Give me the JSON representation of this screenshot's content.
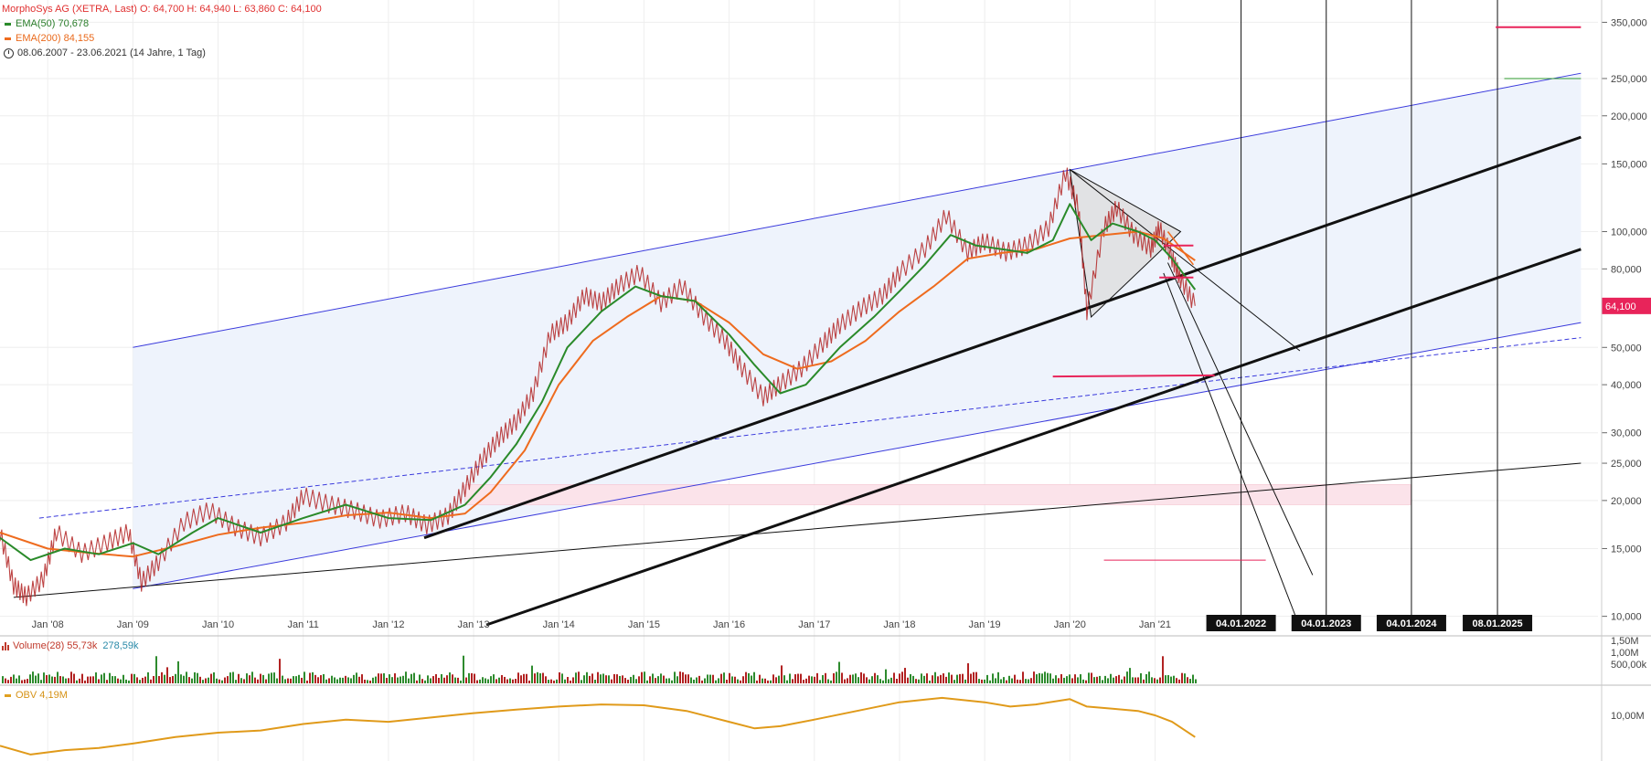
{
  "legend": {
    "title": "MorphoSys AG (XETRA, Last)  O: 64,700  H: 64,940  L: 63,860  C: 64,100",
    "ema50": "EMA(50)  70,678",
    "ema200": "EMA(200)  84,155",
    "range": "08.06.2007 - 23.06.2021   (14 Jahre, 1 Tag)"
  },
  "volume_legend": {
    "label": "Volume(28)  55,73k",
    "avg": "278,59k"
  },
  "obv_legend": {
    "label": "OBV  4,19M"
  },
  "colors": {
    "price_up": "#2e8b2e",
    "price_down": "#b22222",
    "ema50": "#2a8a2a",
    "ema200": "#ee6b1e",
    "channel": "#3a3adc",
    "channel_fill": "#eef3fc",
    "support_band": "#fbe3ea",
    "red_marker": "#e8245a",
    "obv": "#e09a1a",
    "last_price_badge": "#e8245a",
    "date_badge": "#111111"
  },
  "chart_data": {
    "type": "line",
    "title": "MorphoSys AG (XETRA, Last)",
    "y_scale": "log",
    "ylim": [
      9.5,
      400
    ],
    "xlim": [
      2007.44,
      2026.2
    ],
    "x_ticks": [
      {
        "x": 2008.0,
        "label": "Jan '08"
      },
      {
        "x": 2009.0,
        "label": "Jan '09"
      },
      {
        "x": 2010.0,
        "label": "Jan '10"
      },
      {
        "x": 2011.0,
        "label": "Jan '11"
      },
      {
        "x": 2012.0,
        "label": "Jan '12"
      },
      {
        "x": 2013.0,
        "label": "Jan '13"
      },
      {
        "x": 2014.0,
        "label": "Jan '14"
      },
      {
        "x": 2015.0,
        "label": "Jan '15"
      },
      {
        "x": 2016.0,
        "label": "Jan '16"
      },
      {
        "x": 2017.0,
        "label": "Jan '17"
      },
      {
        "x": 2018.0,
        "label": "Jan '18"
      },
      {
        "x": 2019.0,
        "label": "Jan '19"
      },
      {
        "x": 2020.0,
        "label": "Jan '20"
      },
      {
        "x": 2021.0,
        "label": "Jan '21"
      }
    ],
    "y_ticks": [
      {
        "v": 350,
        "label": "350,000"
      },
      {
        "v": 250,
        "label": "250,000"
      },
      {
        "v": 200,
        "label": "200,000"
      },
      {
        "v": 150,
        "label": "150,000"
      },
      {
        "v": 100,
        "label": "100,000"
      },
      {
        "v": 80,
        "label": "80,000"
      },
      {
        "v": 50,
        "label": "50,000"
      },
      {
        "v": 40,
        "label": "40,000"
      },
      {
        "v": 30,
        "label": "30,000"
      },
      {
        "v": 25,
        "label": "25,000"
      },
      {
        "v": 20,
        "label": "20,000"
      },
      {
        "v": 15,
        "label": "15,000"
      },
      {
        "v": 10,
        "label": "10,000"
      }
    ],
    "last_price": {
      "value": 64.1,
      "label": "64,100"
    },
    "date_markers": [
      {
        "x": 2022.01,
        "label": "04.01.2022"
      },
      {
        "x": 2023.01,
        "label": "04.01.2023"
      },
      {
        "x": 2024.01,
        "label": "04.01.2024"
      },
      {
        "x": 2025.02,
        "label": "08.01.2025"
      }
    ],
    "series": [
      {
        "name": "EMA(50)",
        "last": 70.678
      },
      {
        "name": "EMA(200)",
        "last": 84.155
      }
    ],
    "price": {
      "x": [
        2007.44,
        2007.6,
        2007.75,
        2007.95,
        2008.1,
        2008.4,
        2008.7,
        2008.95,
        2009.1,
        2009.3,
        2009.6,
        2009.9,
        2010.2,
        2010.5,
        2010.8,
        2011.0,
        2011.3,
        2011.6,
        2011.9,
        2012.2,
        2012.45,
        2012.7,
        2012.9,
        2013.1,
        2013.3,
        2013.5,
        2013.7,
        2013.9,
        2014.1,
        2014.3,
        2014.5,
        2014.7,
        2014.95,
        2015.2,
        2015.45,
        2015.7,
        2015.95,
        2016.15,
        2016.4,
        2016.6,
        2016.85,
        2017.1,
        2017.3,
        2017.55,
        2017.8,
        2018.0,
        2018.3,
        2018.55,
        2018.8,
        2019.0,
        2019.25,
        2019.5,
        2019.75,
        2019.95,
        2020.1,
        2020.2,
        2020.4,
        2020.55,
        2020.75,
        2020.95,
        2021.05,
        2021.2,
        2021.3,
        2021.47
      ],
      "y": [
        16.5,
        12.0,
        11.2,
        12.5,
        16.5,
        14.5,
        15.5,
        16.5,
        12.2,
        13.8,
        17.5,
        18.8,
        17.0,
        16.0,
        17.5,
        20.5,
        19.5,
        18.8,
        17.8,
        18.5,
        17.2,
        18.2,
        21.5,
        25.5,
        29.0,
        32.0,
        38.0,
        54.0,
        58.0,
        68.0,
        65.0,
        72.0,
        78.0,
        65.0,
        72.0,
        60.0,
        52.0,
        44.0,
        37.0,
        40.0,
        44.0,
        51.0,
        57.0,
        63.0,
        68.0,
        78.0,
        90.0,
        110.0,
        88.0,
        94.0,
        88.0,
        92.0,
        102.0,
        142.0,
        115.0,
        62.0,
        102.0,
        115.0,
        98.0,
        90.0,
        102.0,
        85.0,
        75.0,
        64.1
      ]
    },
    "ema50": {
      "x": [
        2007.44,
        2007.8,
        2008.2,
        2008.6,
        2009.0,
        2009.3,
        2009.7,
        2010.0,
        2010.5,
        2011.0,
        2011.5,
        2012.0,
        2012.5,
        2012.9,
        2013.2,
        2013.5,
        2013.8,
        2014.1,
        2014.5,
        2014.9,
        2015.2,
        2015.6,
        2016.0,
        2016.3,
        2016.6,
        2016.9,
        2017.3,
        2017.7,
        2018.0,
        2018.3,
        2018.6,
        2018.9,
        2019.2,
        2019.5,
        2019.8,
        2020.0,
        2020.25,
        2020.5,
        2020.8,
        2021.0,
        2021.2,
        2021.47
      ],
      "y": [
        16.0,
        14.0,
        15.0,
        14.5,
        15.5,
        14.5,
        16.5,
        18.0,
        16.5,
        18.0,
        19.5,
        18.0,
        17.8,
        19.5,
        23.0,
        28.0,
        36.0,
        50.0,
        62.0,
        72.0,
        68.0,
        66.0,
        54.0,
        45.0,
        38.0,
        40.0,
        50.0,
        60.0,
        70.0,
        82.0,
        98.0,
        92.0,
        90.0,
        88.0,
        95.0,
        118.0,
        95.0,
        105.0,
        100.0,
        95.0,
        85.0,
        70.678
      ]
    },
    "ema200": {
      "x": [
        2007.44,
        2008.0,
        2008.5,
        2009.0,
        2009.5,
        2010.0,
        2010.5,
        2011.0,
        2011.5,
        2012.0,
        2012.5,
        2012.9,
        2013.2,
        2013.6,
        2014.0,
        2014.4,
        2014.8,
        2015.2,
        2015.6,
        2016.0,
        2016.4,
        2016.8,
        2017.2,
        2017.6,
        2018.0,
        2018.4,
        2018.8,
        2019.2,
        2019.6,
        2020.0,
        2020.4,
        2020.8,
        2021.1,
        2021.47
      ],
      "y": [
        16.5,
        15.0,
        14.6,
        14.3,
        15.2,
        16.3,
        17.0,
        17.5,
        18.3,
        18.6,
        18.0,
        18.5,
        21.0,
        27.0,
        40.0,
        52.0,
        60.0,
        68.0,
        66.0,
        58.0,
        48.0,
        44.0,
        46.0,
        52.0,
        62.0,
        72.0,
        85.0,
        88.0,
        90.0,
        96.0,
        98.0,
        100.0,
        96.0,
        84.155
      ]
    },
    "obv": {
      "x": [
        2007.44,
        2007.8,
        2008.2,
        2008.6,
        2009.0,
        2009.5,
        2010.0,
        2010.5,
        2011.0,
        2011.5,
        2012.0,
        2012.5,
        2013.0,
        2013.5,
        2014.0,
        2014.5,
        2015.0,
        2015.5,
        2016.0,
        2016.3,
        2016.6,
        2017.0,
        2017.5,
        2018.0,
        2018.5,
        2019.0,
        2019.3,
        2019.6,
        2020.0,
        2020.2,
        2020.5,
        2020.8,
        2021.0,
        2021.2,
        2021.47
      ],
      "y": [
        0.55,
        0.35,
        0.45,
        0.5,
        0.6,
        0.75,
        0.85,
        0.9,
        1.05,
        1.15,
        1.1,
        1.2,
        1.3,
        1.38,
        1.45,
        1.5,
        1.48,
        1.35,
        1.1,
        0.95,
        1.0,
        1.15,
        1.35,
        1.55,
        1.65,
        1.55,
        1.45,
        1.5,
        1.62,
        1.45,
        1.4,
        1.35,
        1.25,
        1.1,
        0.75
      ]
    },
    "obv_ylim": [
      0.2,
      1.9
    ],
    "obv_tick": {
      "v": 1.25,
      "label": "10,00M"
    },
    "volume_ticks": [
      {
        "label": "1,50M"
      },
      {
        "label": "1,00M"
      },
      {
        "label": "500,00k"
      }
    ],
    "channel": {
      "upper": [
        [
          2009.0,
          50.0
        ],
        [
          2026.0,
          258.0
        ]
      ],
      "lower": [
        [
          2009.0,
          11.8
        ],
        [
          2026.0,
          58.0
        ]
      ],
      "mid_dashed": [
        [
          2007.9,
          18.0
        ],
        [
          2026.0,
          53.0
        ]
      ]
    },
    "trendlines": [
      {
        "pts": [
          [
            2007.6,
            11.2
          ],
          [
            2026.0,
            25.0
          ]
        ],
        "w": 1
      },
      {
        "pts": [
          [
            2012.42,
            16.0
          ],
          [
            2026.0,
            176.0
          ]
        ],
        "w": 3
      },
      {
        "pts": [
          [
            2013.15,
            9.5
          ],
          [
            2026.0,
            90.0
          ]
        ],
        "w": 3
      },
      {
        "pts": [
          [
            2020.0,
            145.0
          ],
          [
            2022.7,
            49.0
          ]
        ],
        "w": 1
      },
      {
        "pts": [
          [
            2021.15,
            83.0
          ],
          [
            2022.85,
            12.8
          ]
        ],
        "w": 1
      },
      {
        "pts": [
          [
            2021.1,
            78.0
          ],
          [
            2022.65,
            10.0
          ]
        ],
        "w": 1
      }
    ],
    "triangle": [
      [
        2020.0,
        145.0
      ],
      [
        2020.25,
        60.0
      ],
      [
        2021.3,
        100.0
      ]
    ],
    "red_lines": [
      {
        "pts": [
          [
            2019.8,
            42.0
          ],
          [
            2021.7,
            42.3
          ]
        ],
        "w": 2
      },
      {
        "pts": [
          [
            2020.4,
            14.0
          ],
          [
            2022.3,
            14.0
          ]
        ],
        "w": 1
      },
      {
        "pts": [
          [
            2025.0,
            340.0
          ],
          [
            2026.0,
            340.0
          ]
        ],
        "w": 2
      },
      {
        "pts": [
          [
            2021.1,
            92.0
          ],
          [
            2021.45,
            92.0
          ]
        ],
        "w": 2
      },
      {
        "pts": [
          [
            2021.05,
            76.0
          ],
          [
            2021.45,
            76.0
          ]
        ],
        "w": 2
      }
    ],
    "green_line": [
      [
        2025.1,
        250.0
      ],
      [
        2026.0,
        250.0
      ]
    ],
    "orange_proj": [
      [
        2021.15,
        100.0
      ],
      [
        2021.45,
        82.0
      ]
    ],
    "support_band": {
      "x": [
        2012.9,
        2024.0
      ],
      "y": [
        19.5,
        22.0
      ]
    }
  }
}
